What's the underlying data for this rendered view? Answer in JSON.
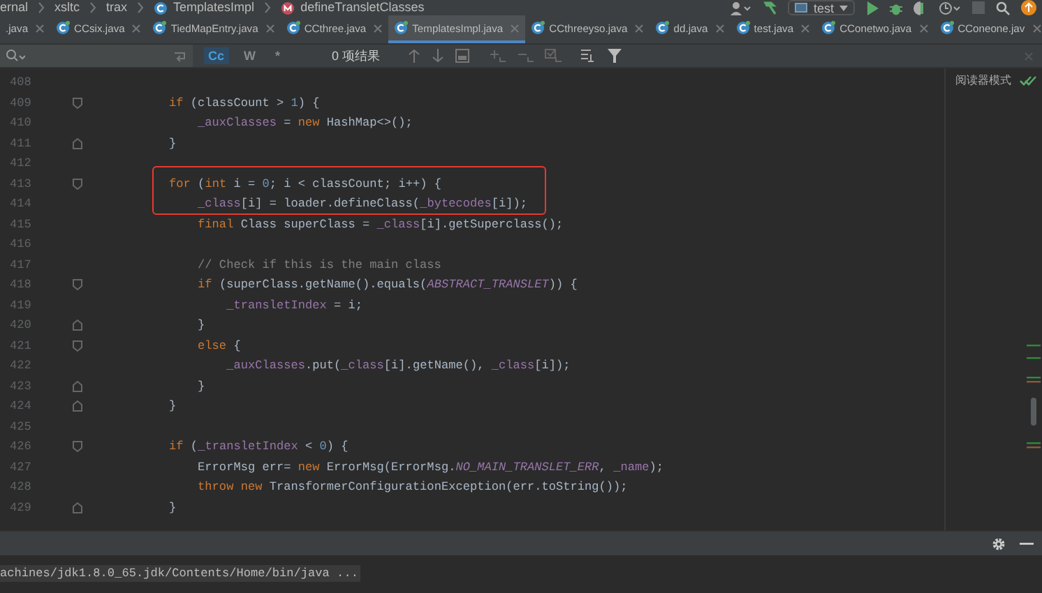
{
  "breadcrumb": [
    {
      "label": "ernal",
      "kind": "package"
    },
    {
      "label": "xsltc",
      "kind": "package"
    },
    {
      "label": "trax",
      "kind": "package"
    },
    {
      "label": "TemplatesImpl",
      "kind": "class"
    },
    {
      "label": "defineTransletClasses",
      "kind": "method"
    }
  ],
  "toolbar": {
    "run_config": "test"
  },
  "tabs": [
    {
      "label": ".java",
      "selected": false,
      "icon": false
    },
    {
      "label": "CCsix.java",
      "selected": false,
      "icon": true
    },
    {
      "label": "TiedMapEntry.java",
      "selected": false,
      "icon": true
    },
    {
      "label": "CCthree.java",
      "selected": false,
      "icon": true
    },
    {
      "label": "TemplatesImpl.java",
      "selected": true,
      "icon": true
    },
    {
      "label": "CCthreeyso.java",
      "selected": false,
      "icon": true
    },
    {
      "label": "dd.java",
      "selected": false,
      "icon": true
    },
    {
      "label": "test.java",
      "selected": false,
      "icon": true
    },
    {
      "label": "CConetwo.java",
      "selected": false,
      "icon": true
    },
    {
      "label": "CConeone.jav",
      "selected": false,
      "icon": true
    }
  ],
  "search": {
    "options": [
      {
        "label": "Cc",
        "selected": true
      },
      {
        "label": "W",
        "selected": false
      },
      {
        "label": "*",
        "selected": false
      }
    ],
    "result": "0 项结果"
  },
  "editor": {
    "reader_mode": "阅读器模式",
    "lines": [
      {
        "number": "408",
        "fold_start": false,
        "fold_end": false
      },
      {
        "number": "409",
        "fold_start": true,
        "fold_end": false,
        "tokens": [
          {
            "kind": "keyword",
            "text": "if"
          },
          {
            "kind": "plain",
            "text": " (classCount > "
          },
          {
            "kind": "number",
            "text": "1"
          },
          {
            "kind": "plain",
            "text": ") {"
          }
        ]
      },
      {
        "number": "410",
        "fold_start": false,
        "fold_end": false,
        "tokens": [
          {
            "kind": "field",
            "text": "_auxClasses"
          },
          {
            "kind": "plain",
            "text": " = "
          },
          {
            "kind": "keyword",
            "text": "new"
          },
          {
            "kind": "plain",
            "text": " HashMap<>();"
          }
        ]
      },
      {
        "number": "411",
        "fold_start": false,
        "fold_end": true,
        "tokens": [
          {
            "kind": "plain",
            "text": "}"
          }
        ]
      },
      {
        "number": "412",
        "fold_start": false,
        "fold_end": false
      },
      {
        "number": "413",
        "fold_start": true,
        "fold_end": false,
        "tokens": [
          {
            "kind": "keyword",
            "text": "for"
          },
          {
            "kind": "plain",
            "text": " ("
          },
          {
            "kind": "keyword",
            "text": "int"
          },
          {
            "kind": "plain",
            "text": " i = "
          },
          {
            "kind": "number",
            "text": "0"
          },
          {
            "kind": "plain",
            "text": "; i < classCount; i++) {"
          }
        ]
      },
      {
        "number": "414",
        "fold_start": false,
        "fold_end": false,
        "tokens": [
          {
            "kind": "field",
            "text": "_class"
          },
          {
            "kind": "plain",
            "text": "[i] = loader.defineClass("
          },
          {
            "kind": "field",
            "text": "_bytecodes"
          },
          {
            "kind": "plain",
            "text": "[i]);"
          }
        ]
      },
      {
        "number": "415",
        "fold_start": false,
        "fold_end": false,
        "tokens": [
          {
            "kind": "keyword",
            "text": "final"
          },
          {
            "kind": "plain",
            "text": " Class superClass = "
          },
          {
            "kind": "field",
            "text": "_class"
          },
          {
            "kind": "plain",
            "text": "[i].getSuperclass();"
          }
        ]
      },
      {
        "number": "416",
        "fold_start": false,
        "fold_end": false
      },
      {
        "number": "417",
        "fold_start": false,
        "fold_end": false,
        "tokens": [
          {
            "kind": "comment",
            "text": "// Check if this is the main class"
          }
        ]
      },
      {
        "number": "418",
        "fold_start": true,
        "fold_end": false,
        "tokens": [
          {
            "kind": "keyword",
            "text": "if"
          },
          {
            "kind": "plain",
            "text": " (superClass.getName().equals("
          },
          {
            "kind": "constant",
            "text": "ABSTRACT_TRANSLET"
          },
          {
            "kind": "plain",
            "text": ")) {"
          }
        ]
      },
      {
        "number": "419",
        "fold_start": false,
        "fold_end": false,
        "tokens": [
          {
            "kind": "field",
            "text": "_transletIndex"
          },
          {
            "kind": "plain",
            "text": " = i;"
          }
        ]
      },
      {
        "number": "420",
        "fold_start": false,
        "fold_end": true,
        "tokens": [
          {
            "kind": "plain",
            "text": "}"
          }
        ]
      },
      {
        "number": "421",
        "fold_start": true,
        "fold_end": false,
        "tokens": [
          {
            "kind": "keyword",
            "text": "else"
          },
          {
            "kind": "plain",
            "text": " {"
          }
        ]
      },
      {
        "number": "422",
        "fold_start": false,
        "fold_end": false,
        "tokens": [
          {
            "kind": "field",
            "text": "_auxClasses"
          },
          {
            "kind": "plain",
            "text": ".put("
          },
          {
            "kind": "field",
            "text": "_class"
          },
          {
            "kind": "plain",
            "text": "[i].getName(), "
          },
          {
            "kind": "field",
            "text": "_class"
          },
          {
            "kind": "plain",
            "text": "[i]);"
          }
        ]
      },
      {
        "number": "423",
        "fold_start": false,
        "fold_end": true,
        "tokens": [
          {
            "kind": "plain",
            "text": "}"
          }
        ]
      },
      {
        "number": "424",
        "fold_start": false,
        "fold_end": true,
        "tokens": [
          {
            "kind": "plain",
            "text": "}"
          }
        ]
      },
      {
        "number": "425",
        "fold_start": false,
        "fold_end": false
      },
      {
        "number": "426",
        "fold_start": true,
        "fold_end": false,
        "tokens": [
          {
            "kind": "keyword",
            "text": "if"
          },
          {
            "kind": "plain",
            "text": " ("
          },
          {
            "kind": "field",
            "text": "_transletIndex"
          },
          {
            "kind": "plain",
            "text": " < "
          },
          {
            "kind": "number",
            "text": "0"
          },
          {
            "kind": "plain",
            "text": ") {"
          }
        ]
      },
      {
        "number": "427",
        "fold_start": false,
        "fold_end": false,
        "tokens": [
          {
            "kind": "plain",
            "text": "ErrorMsg err= "
          },
          {
            "kind": "keyword",
            "text": "new"
          },
          {
            "kind": "plain",
            "text": " ErrorMsg(ErrorMsg."
          },
          {
            "kind": "constant",
            "text": "NO_MAIN_TRANSLET_ERR"
          },
          {
            "kind": "plain",
            "text": ", "
          },
          {
            "kind": "field",
            "text": "_name"
          },
          {
            "kind": "plain",
            "text": ");"
          }
        ]
      },
      {
        "number": "428",
        "fold_start": false,
        "fold_end": false,
        "tokens": [
          {
            "kind": "keyword",
            "text": "throw new"
          },
          {
            "kind": "plain",
            "text": " TransformerConfigurationException(err.toString());"
          }
        ]
      },
      {
        "number": "429",
        "fold_start": false,
        "fold_end": true,
        "tokens": [
          {
            "kind": "plain",
            "text": "}"
          }
        ]
      }
    ]
  },
  "console": {
    "text": "achines/jdk1.8.0_65.jdk/Contents/Home/bin/java ..."
  }
}
